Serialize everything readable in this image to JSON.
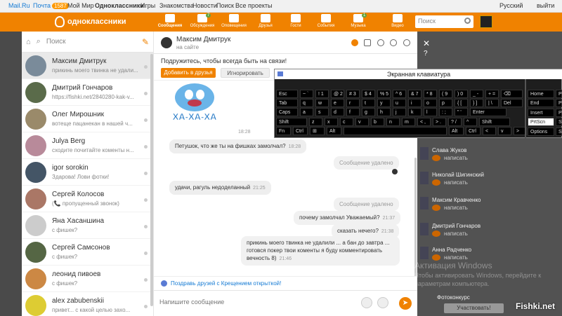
{
  "topbar": {
    "mailru": "Mail.Ru",
    "mail": "Почта",
    "mail_count": "1587",
    "myworld": "Мой Мир",
    "ok": "Одноклассники",
    "games": "Игры",
    "dating": "Знакомства",
    "news": "Новости",
    "search": "Поиск",
    "all_projects": "Все проекты",
    "lang": "Русский",
    "exit": "выйти"
  },
  "header": {
    "logo": "одноклассники",
    "search_placeholder": "Поиск",
    "nav": [
      {
        "label": "Сообщения",
        "badge": ""
      },
      {
        "label": "Обсуждения",
        "badge": "7"
      },
      {
        "label": "Оповещения",
        "badge": ""
      },
      {
        "label": "Друзья",
        "badge": ""
      },
      {
        "label": "Гости",
        "badge": ""
      },
      {
        "label": "События",
        "badge": ""
      },
      {
        "label": "Музыка",
        "badge": "1"
      },
      {
        "label": "Видео",
        "badge": ""
      }
    ]
  },
  "sidebar": {
    "search_placeholder": "Поиск",
    "dialogs": [
      {
        "name": "Максим Дмитрук",
        "preview": "прикинь моего твинка не удали...",
        "color": "#7a8b9a"
      },
      {
        "name": "Дмитрий Гончаров",
        "preview": "https://fishki.net/2840280-kak-v...",
        "color": "#5a6b4a"
      },
      {
        "name": "Олег Мирошник",
        "preview": "вотеще пацанекан в нашей ч...",
        "color": "#9a8a6a"
      },
      {
        "name": "Julya Berg",
        "preview": "сходите почитайте коменты н...",
        "color": "#b88a9a"
      },
      {
        "name": "igor sorokin",
        "preview": "Здарова! Лови фотки!",
        "color": "#445566"
      },
      {
        "name": "Сергей Колосов",
        "preview": "(📞 пропущенный звонок)",
        "color": "#aa7766"
      },
      {
        "name": "Яна Хасаншина",
        "preview": "с фишек?",
        "color": "#cccccc"
      },
      {
        "name": "Сергей Самсонов",
        "preview": "с фишек?",
        "color": "#556644"
      },
      {
        "name": "леонид пивоев",
        "preview": "с фишек?",
        "color": "#cc8844"
      },
      {
        "name": "alex zabubenskii",
        "preview": "привет... с какой целью захо...",
        "color": "#ddcc33"
      }
    ]
  },
  "conversation": {
    "name": "Максим Дмитрук",
    "status": "на сайте",
    "friend_prompt": "Подружитесь, чтобы всегда быть на связи!",
    "add_friend": "Добавить в друзья",
    "ignore": "Игнорировать",
    "sticker_text": "ХА-ХА-ХА",
    "sticker_time": "18:28",
    "messages": [
      {
        "text": "Петушок, что же ты на фишках замолчал?",
        "time": "18:28",
        "dir": "in"
      },
      {
        "text": "Сообщение удалено",
        "time": "",
        "dir": "out",
        "deleted": true
      },
      {
        "text": "удачи, рагуль недоделанный",
        "time": "21:25",
        "dir": "in"
      },
      {
        "text": "Сообщение удалено",
        "time": "",
        "dir": "out",
        "deleted": true
      },
      {
        "text": "почему замолчал Уважаемый?",
        "time": "21:37",
        "dir": "out"
      },
      {
        "text": "сказать нечего?",
        "time": "21:38",
        "dir": "out"
      },
      {
        "text": "прикинь моего твинка не удалили ... а бан до завтра ... готовся покер твои коменты я буду комментировать вечность 8)",
        "time": "21:46",
        "dir": "out"
      }
    ],
    "promo": "Поздравь друзей с Крещением открыткой!",
    "input_placeholder": "Напишите сообщение"
  },
  "rightpanel": {
    "items": [
      {
        "name": "Слава Жуков",
        "write": "написать"
      },
      {
        "name": "Николай Шигинский",
        "write": "написать"
      },
      {
        "name": "Максим Кравченко",
        "write": "написать"
      },
      {
        "name": "Дмитрий Гончаров",
        "write": "написать"
      },
      {
        "name": "Анна Радченко",
        "write": "написать"
      }
    ],
    "contest": "Фотоконкурс",
    "participate": "Участвовать!"
  },
  "keyboard": {
    "title": "Экранная клавиатура",
    "rows": [
      [
        "Esc",
        "~ `",
        "! 1",
        "@ 2",
        "# 3",
        "$ 4",
        "% 5",
        "^ 6",
        "& 7",
        "* 8",
        "( 9",
        ") 0",
        "_ -",
        "+ =",
        "⌫"
      ],
      [
        "Tab",
        "q",
        "w",
        "e",
        "r",
        "t",
        "y",
        "u",
        "i",
        "o",
        "p",
        "{ [",
        "} ]",
        "| \\",
        "Del"
      ],
      [
        "Caps",
        "a",
        "s",
        "d",
        "f",
        "g",
        "h",
        "j",
        "k",
        "l",
        ": ;",
        "\" '",
        "Enter"
      ],
      [
        "Shift",
        "z",
        "x",
        "c",
        "v",
        "b",
        "n",
        "m",
        "< ,",
        "> .",
        "? /",
        "^",
        "Shift"
      ],
      [
        "Fn",
        "Ctrl",
        "⊞",
        "Alt",
        "",
        "Alt",
        "Ctrl",
        "<",
        "v",
        ">"
      ]
    ],
    "side": [
      "Home",
      "End",
      "Insert",
      "PrtScn",
      "Options"
    ],
    "side2": [
      "Pg",
      "Pg",
      "Pa",
      "Sc",
      "Sc"
    ]
  },
  "watermark": {
    "line1": "Активация Windows",
    "line2": "Чтобы активировать Windows, перейдите к",
    "line3": "параметрам компьютера."
  },
  "site": "Fishki.net"
}
